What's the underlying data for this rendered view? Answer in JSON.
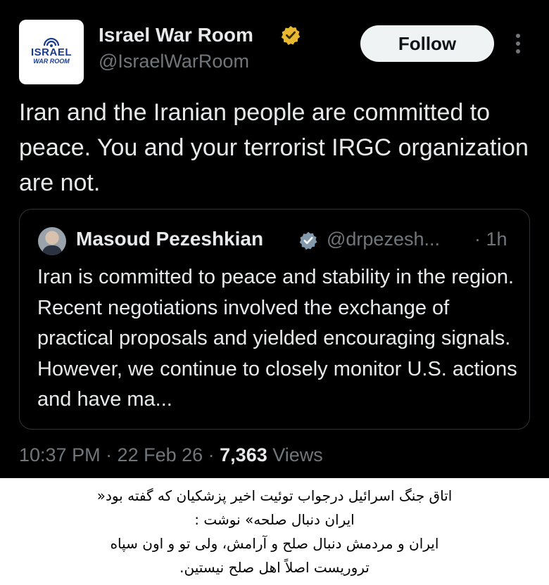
{
  "author": {
    "display_name": "Israel War Room",
    "handle": "@IsraelWarRoom",
    "avatar_logo_line1": "ISRAEL",
    "avatar_logo_line2": "WAR ROOM",
    "verified_icon": "gold-verified-badge-icon",
    "verified_color": "#e8b830"
  },
  "follow_label": "Follow",
  "more_icon": "more-vertical-icon",
  "tweet_text": "Iran and the Iranian people are committed to peace. You and your terrorist IRGC organization are not.",
  "quote": {
    "name": "Masoud Pezeshkian",
    "handle": "@drpezesh...",
    "time": "· 1h",
    "verified_icon": "grey-verified-badge-icon",
    "text": "Iran is committed to peace and stability in the region. Recent negotiations involved the exchange of practical proposals and yielded encouraging signals. However, we continue to closely monitor U.S. actions and have ma..."
  },
  "meta": {
    "time_date": "10:37 PM · 22 Feb 26 · ",
    "views_count": "7,363",
    "views_label": " Views"
  },
  "caption": {
    "lines": [
      "اتاق جنگ اسرائیل درجواب توئیت اخیر پزشکیان که گفته بود«",
      "ایران دنبال صلحه» نوشت :",
      "ایران و مردمش دنبال صلح و آرامش، ولی تو و اون سپاه",
      "تروریست اصلاً اهل صلح نیستین."
    ]
  },
  "colors": {
    "background": "#000000",
    "text": "#e7e9ea",
    "secondary_text": "#71767b",
    "follow_button_bg": "#eff3f4"
  }
}
